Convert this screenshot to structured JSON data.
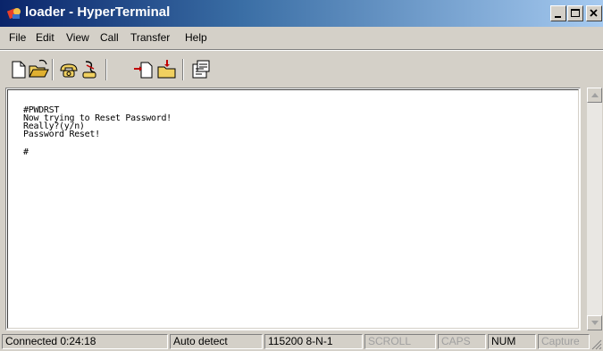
{
  "window": {
    "title": "loader - HyperTerminal",
    "app_icon": "hyperterminal-icon",
    "controls": [
      "minimize-icon",
      "maximize-icon",
      "close-icon"
    ]
  },
  "menu": {
    "file": "File",
    "edit": "Edit",
    "view": "View",
    "call": "Call",
    "transfer": "Transfer",
    "help": "Help"
  },
  "toolbar": {
    "buttons": [
      "new-connection-icon",
      "open-icon",
      "call-icon",
      "disconnect-icon",
      "send-icon",
      "receive-icon",
      "properties-icon"
    ]
  },
  "terminal": {
    "lines": [
      "#PWDRST",
      "Now trying to Reset Password!",
      "Really?(y/n)",
      "Password Reset!",
      "",
      "#"
    ]
  },
  "status": {
    "connected": "Connected 0:24:18",
    "detect": "Auto detect",
    "settings": "115200 8-N-1",
    "scroll": "SCROLL",
    "caps": "CAPS",
    "num": "NUM",
    "capture": "Capture"
  },
  "colors": {
    "title_start": "#0a246a",
    "title_end": "#a6caf0",
    "chrome": "#d4d0c8"
  }
}
